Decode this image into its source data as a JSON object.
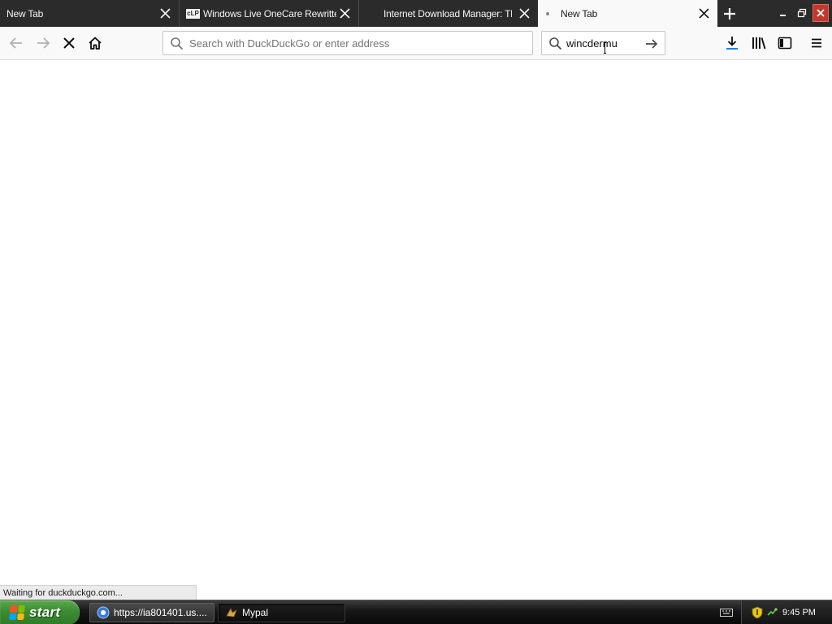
{
  "tabs": [
    {
      "title": "New Tab",
      "favicon": "none"
    },
    {
      "title": "Windows Live OneCare Rewritten",
      "favicon": "clp-icon"
    },
    {
      "title": "Internet Download Manager: The",
      "favicon": "none"
    },
    {
      "title": "New Tab",
      "favicon": "loading-dot",
      "active": true
    }
  ],
  "favicon_clp_text": "cLP",
  "toolbar": {
    "url_placeholder": "Search with DuckDuckGo or enter address",
    "search_value": "wincdermu"
  },
  "status_text": "Waiting for duckduckgo.com...",
  "taskbar": {
    "start_label": "start",
    "tasks": [
      {
        "label": "https://ia801401.us....",
        "icon": "browser-globe-icon"
      },
      {
        "label": "Mypal",
        "icon": "mypal-icon"
      }
    ],
    "clock": "9:45 PM"
  },
  "colors": {
    "tabstrip_bg": "#2b2b2b",
    "toolbar_bg": "#f9f9fa",
    "taskbar_bg": "#161616",
    "start_green": "#3c8c33",
    "download_accent": "#0a84ff"
  }
}
